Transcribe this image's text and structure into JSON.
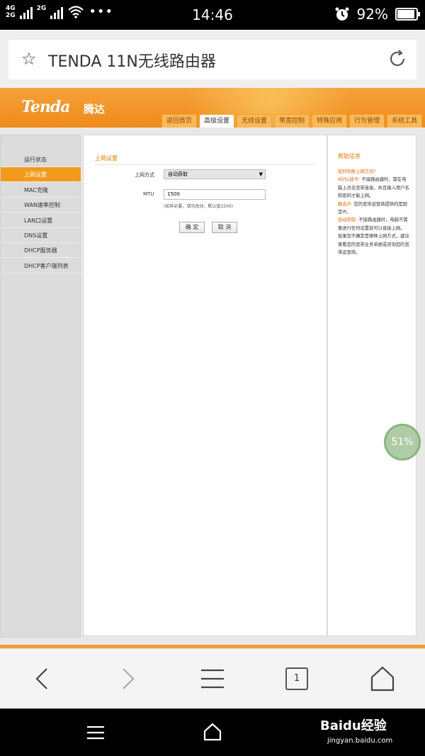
{
  "status_bar": {
    "net_top": "4G",
    "net_bottom": "2G",
    "net_top2": "2G",
    "time": "14:46",
    "battery_pct": "92%",
    "battery_level": 0.92
  },
  "browser": {
    "page_title": "TENDA 11N无线路由器",
    "tab_count": "1"
  },
  "router": {
    "logo": "Tenda",
    "logo_cn": "腾达",
    "tabs": [
      "返回首页",
      "高级设置",
      "无线设置",
      "带宽控制",
      "特殊应用",
      "行为管理",
      "系统工具"
    ],
    "active_tab": "高级设置",
    "sidebar": [
      "运行状态",
      "上网设置",
      "MAC克隆",
      "WAN速率控制",
      "LAN口设置",
      "DNS设置",
      "DHCP服务器",
      "DHCP客户端列表"
    ],
    "active_sidebar": "上网设置",
    "section_title": "上网设置",
    "wan_type_label": "上网方式",
    "wan_type_value": "自动获取",
    "mtu_label": "MTU",
    "mtu_value": "1500",
    "mtu_hint": "(如非必要，请勿改动，默认值1500)",
    "ok_label": "确 定",
    "cancel_label": "取 消",
    "help_title": "帮助信息",
    "help": {
      "q": "如何判断上网方式?",
      "adsl_key": "ADSL拨号:",
      "adsl_text": " 不接路由器时，需在电脑上点击宽带连接，并且输入用户名和密码才能上网。",
      "static_key": "静态IP:",
      "static_text": " 您的宽带运营商提供的是固定IP。",
      "dhcp_key": "自动获取:",
      "dhcp_text": " 不接路由器时，电脑不需要进行任何设置就可以直接上网。",
      "tail": "如果您不确定是哪种上网方式，建议查看您的宽带业务单据或咨询您的宽带运营商。"
    }
  },
  "float_progress": "51%",
  "watermark": {
    "brand": "Baidu经验",
    "url": "jingyan.baidu.com"
  }
}
